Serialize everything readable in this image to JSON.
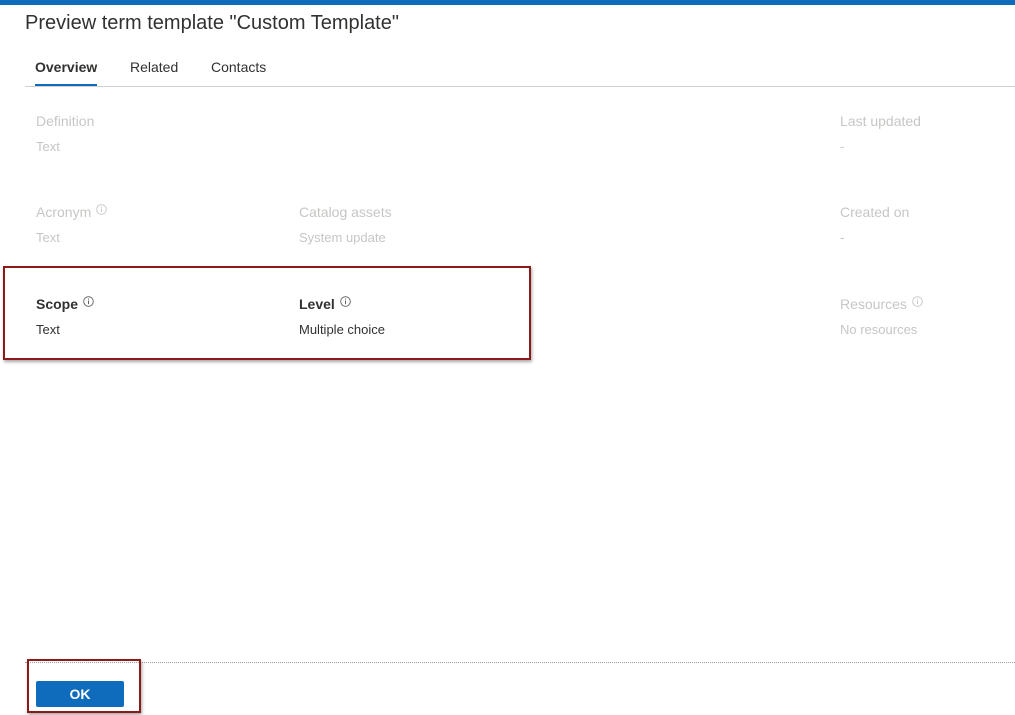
{
  "dialog": {
    "title": "Preview term template \"Custom Template\"",
    "accent_color": "#0f6cbd",
    "highlight_color": "#8b1a1a"
  },
  "tabs": [
    {
      "label": "Overview",
      "active": true
    },
    {
      "label": "Related",
      "active": false
    },
    {
      "label": "Contacts",
      "active": false
    }
  ],
  "fields": {
    "definition": {
      "label": "Definition",
      "value": "Text"
    },
    "last_updated": {
      "label": "Last updated",
      "value": "-"
    },
    "acronym": {
      "label": "Acronym",
      "value": "Text",
      "icon": "info-icon"
    },
    "catalog_assets": {
      "label": "Catalog assets",
      "value": "System update"
    },
    "created_on": {
      "label": "Created on",
      "value": "-"
    },
    "scope": {
      "label": "Scope",
      "value": "Text",
      "icon": "info-icon"
    },
    "level": {
      "label": "Level",
      "value": "Multiple choice",
      "icon": "info-icon"
    },
    "resources": {
      "label": "Resources",
      "value": "No resources",
      "icon": "info-icon"
    }
  },
  "footer": {
    "ok_label": "OK"
  }
}
